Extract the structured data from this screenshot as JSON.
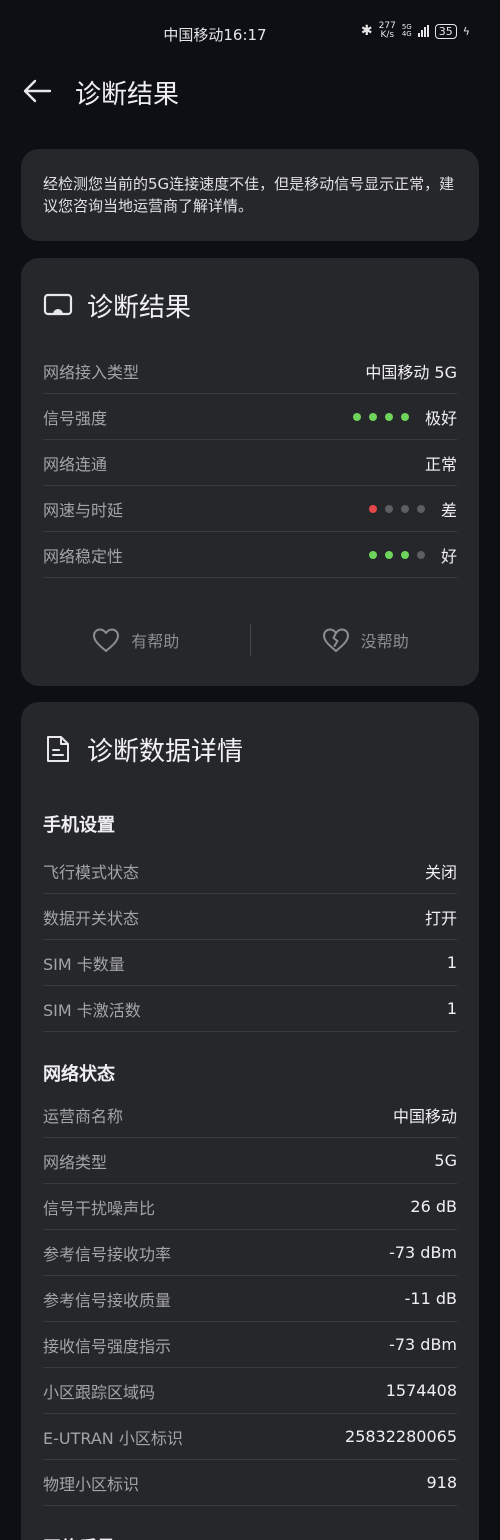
{
  "status_bar": {
    "carrier_time": "中国移动16:17",
    "net_speed_value": "277",
    "net_speed_unit": "K/s",
    "signal_label_top": "5G",
    "signal_label_bottom": "4G",
    "battery": "35"
  },
  "header": {
    "title": "诊断结果"
  },
  "notice": {
    "text": "经检测您当前的5G连接速度不佳，但是移动信号显示正常，建议您咨询当地运营商了解详情。"
  },
  "result": {
    "title": "诊断结果",
    "rows": [
      {
        "label": "网络接入类型",
        "value": "中国移动 5G"
      },
      {
        "label": "信号强度",
        "value": "极好",
        "dots": [
          "#6fd45c",
          "#6fd45c",
          "#6fd45c",
          "#6fd45c"
        ]
      },
      {
        "label": "网络连通",
        "value": "正常"
      },
      {
        "label": "网速与时延",
        "value": "差",
        "dots": [
          "#e3474a",
          "#5c5e62",
          "#5c5e62",
          "#5c5e62"
        ]
      },
      {
        "label": "网络稳定性",
        "value": "好",
        "dots": [
          "#6fd45c",
          "#6fd45c",
          "#6fd45c",
          "#5c5e62"
        ]
      }
    ],
    "helpful_label": "有帮助",
    "not_helpful_label": "没帮助"
  },
  "details": {
    "title": "诊断数据详情",
    "phone_settings": {
      "title": "手机设置",
      "rows": [
        {
          "label": "飞行模式状态",
          "value": "关闭"
        },
        {
          "label": "数据开关状态",
          "value": "打开"
        },
        {
          "label": "SIM 卡数量",
          "value": "1"
        },
        {
          "label": "SIM 卡激活数",
          "value": "1"
        }
      ]
    },
    "network_status": {
      "title": "网络状态",
      "rows": [
        {
          "label": "运营商名称",
          "value": "中国移动"
        },
        {
          "label": "网络类型",
          "value": "5G"
        },
        {
          "label": "信号干扰噪声比",
          "value": "26 dB"
        },
        {
          "label": "参考信号接收功率",
          "value": "-73 dBm"
        },
        {
          "label": "参考信号接收质量",
          "value": "-11 dB"
        },
        {
          "label": "接收信号强度指示",
          "value": "-73 dBm"
        },
        {
          "label": "小区跟踪区域码",
          "value": "1574408"
        },
        {
          "label": "E-UTRAN 小区标识",
          "value": "25832280065"
        },
        {
          "label": "物理小区标识",
          "value": "918"
        }
      ]
    },
    "network_quality": {
      "title": "网络质量"
    }
  },
  "colors": {
    "background": "#0d0f14",
    "card": "#25272b",
    "good": "#6fd45c",
    "bad": "#e3474a",
    "inactive": "#5c5e62"
  }
}
